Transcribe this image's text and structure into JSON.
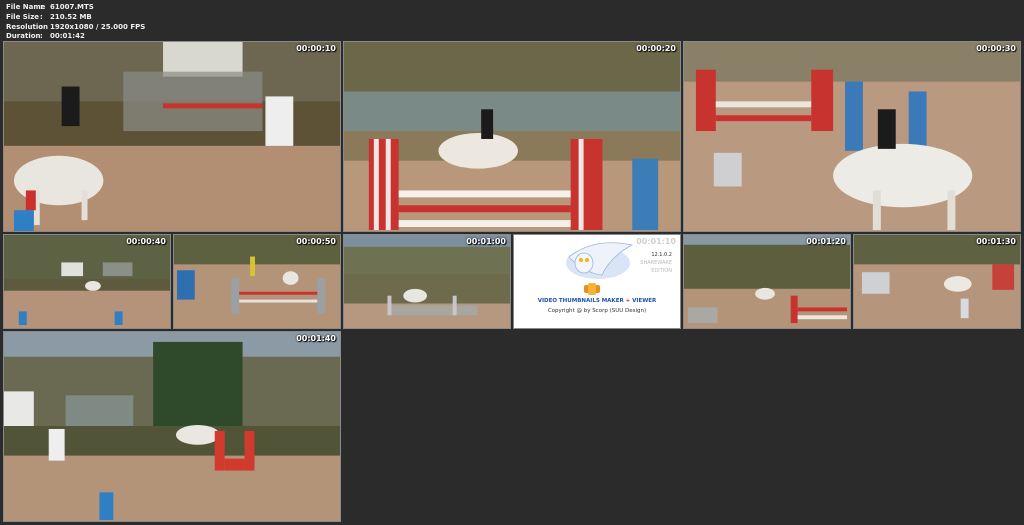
{
  "info": {
    "rows": [
      {
        "key": "File Name",
        "value": "61007.MTS"
      },
      {
        "key": "File Size",
        "value": "210.52 MB"
      },
      {
        "key": "Resolution",
        "value": "1920x1080 / 25.000 FPS"
      },
      {
        "key": "Duration",
        "value": "00:01:42"
      }
    ],
    "separator": ":"
  },
  "thumbnails": [
    {
      "timestamp": "00:00:10"
    },
    {
      "timestamp": "00:00:20"
    },
    {
      "timestamp": "00:00:30"
    },
    {
      "timestamp": "00:00:40"
    },
    {
      "timestamp": "00:00:50"
    },
    {
      "timestamp": "00:01:00"
    },
    {
      "timestamp": "00:01:10"
    },
    {
      "timestamp": "00:01:20"
    },
    {
      "timestamp": "00:01:30"
    },
    {
      "timestamp": "00:01:40"
    }
  ],
  "logo_card": {
    "title_main": "VIDEO THUMBNAILS MAKER",
    "title_plus": "+",
    "title_viewer": "VIEWER",
    "copyright": "Copyright @ by Scorp (SUU Design)",
    "version": "12.1.0.2",
    "edition_line1": "SHAREWARE",
    "edition_line2": "EDITION"
  },
  "colors": {
    "background": "#2b2b2b",
    "info_text": "#f0f0f0",
    "timestamp_text": "#ffffff",
    "fence_red": "#c8332f",
    "arena_sand": "#a9876c"
  }
}
